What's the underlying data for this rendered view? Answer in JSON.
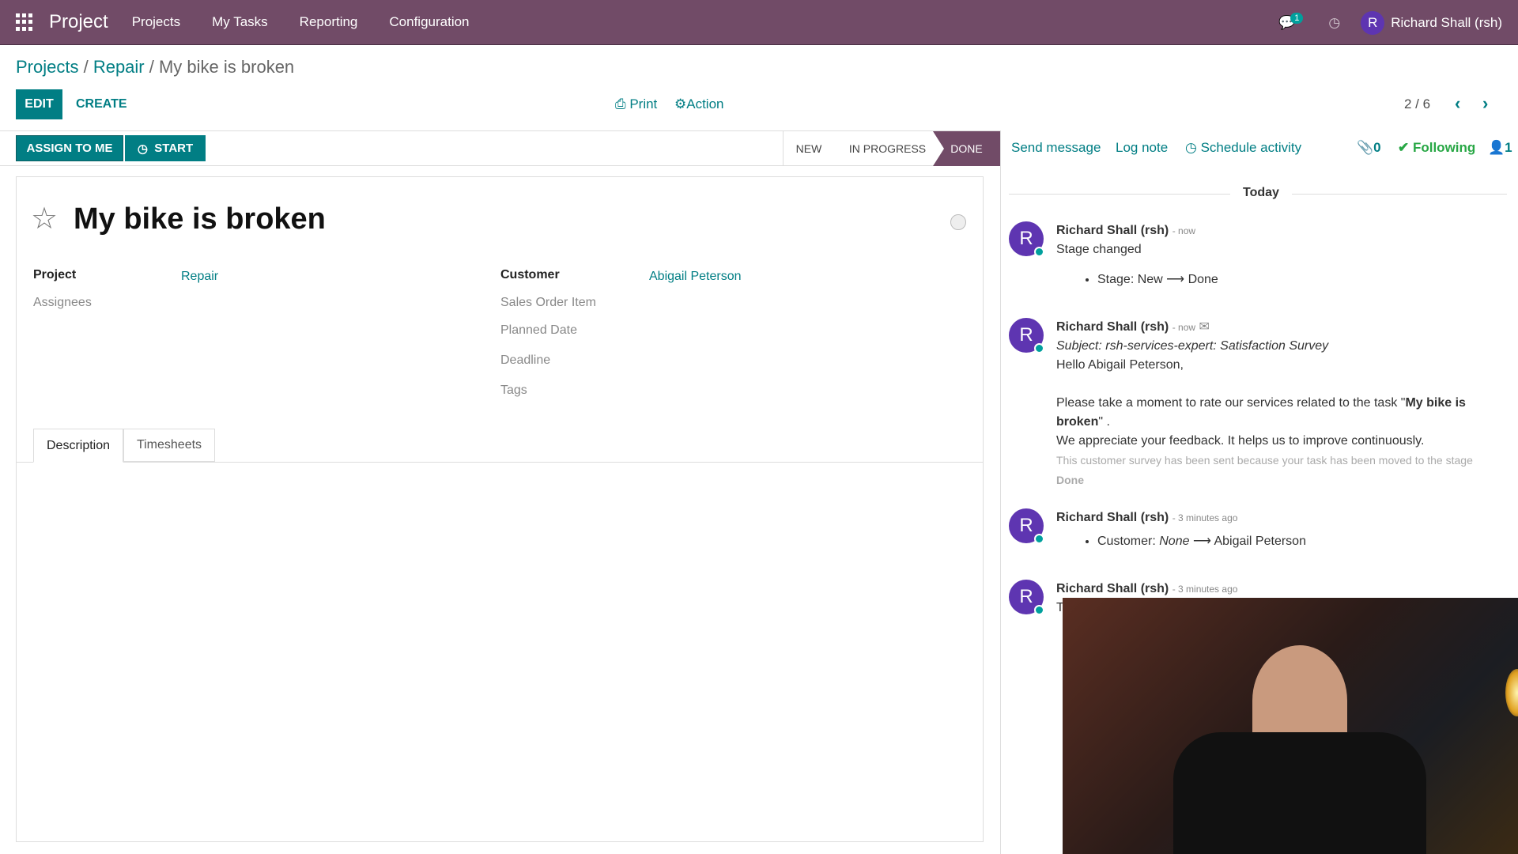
{
  "topbar": {
    "app": "Project",
    "menus": [
      "Projects",
      "My Tasks",
      "Reporting",
      "Configuration"
    ],
    "chat_count": "1",
    "user": "Richard Shall (rsh)",
    "user_initial": "R",
    "color": "#714B67"
  },
  "breadcrumb": {
    "items": [
      "Projects",
      "Repair"
    ],
    "current": "My bike is broken"
  },
  "toolbar": {
    "edit": "EDIT",
    "create": "CREATE",
    "print": "Print",
    "action": "Action",
    "pager": "2 / 6"
  },
  "statusbar": {
    "assign": "ASSIGN TO ME",
    "start": "START",
    "stages": [
      "NEW",
      "IN PROGRESS",
      "DONE"
    ],
    "active_stage": "DONE"
  },
  "form": {
    "title": "My bike is broken",
    "fields_left": [
      {
        "label": "Project",
        "value": "Repair"
      },
      {
        "label": "Assignees",
        "value": ""
      }
    ],
    "fields_right": [
      {
        "label": "Customer",
        "value": "Abigail Peterson"
      },
      {
        "label": "Sales Order Item"
      },
      {
        "label": "Planned Date"
      },
      {
        "label": "Deadline"
      },
      {
        "label": "Tags"
      }
    ],
    "tabs": [
      "Description",
      "Timesheets"
    ],
    "active_tab": "Description"
  },
  "chatter": {
    "send": "Send message",
    "log": "Log note",
    "schedule": "Schedule activity",
    "attachments": "0",
    "following": "Following",
    "followers": "1",
    "date": "Today",
    "messages": [
      {
        "author": "Richard Shall (rsh)",
        "time": "- now",
        "text": "Stage changed",
        "bullet_label": "Stage:",
        "bullet_from": "New",
        "bullet_to": "Done"
      },
      {
        "author": "Richard Shall (rsh)",
        "time": "- now",
        "subject": "Subject: rsh-services-expert: Satisfaction Survey",
        "greeting": "Hello Abigail Peterson,",
        "p1": "Please take a moment to rate our services related to the task \"",
        "p1_bold": "My bike is broken",
        "p1_end": "\" .",
        "p2": "We appreciate your feedback. It helps us to improve continuously.",
        "note": "This customer survey has been sent because your task has been moved to the stage ",
        "note_bold": "Done"
      },
      {
        "author": "Richard Shall (rsh)",
        "time": "- 3 minutes ago",
        "bullet_label": "Customer:",
        "bullet_from": "None",
        "bullet_to": "Abigail Peterson"
      },
      {
        "author": "Richard Shall (rsh)",
        "time": "- 3 minutes ago",
        "text": "T"
      }
    ]
  }
}
